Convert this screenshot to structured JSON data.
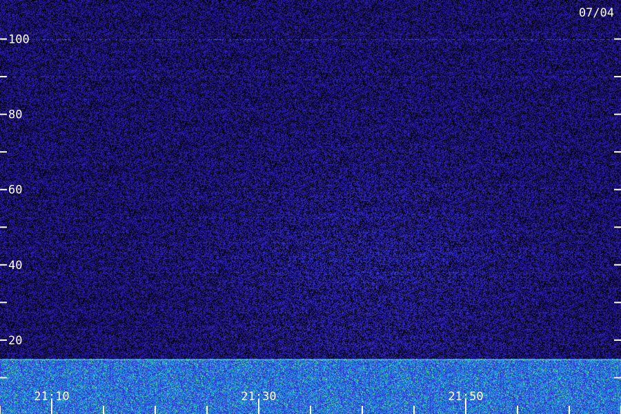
{
  "chart_data": {
    "type": "heatmap",
    "title": "",
    "xlabel": "",
    "ylabel": "",
    "date_label": "07/04",
    "x_tick_labels": [
      "21:10",
      "21:30",
      "21:50"
    ],
    "y_tick_labels": [
      "20",
      "40",
      "60",
      "80",
      "100"
    ],
    "y_tick_values": [
      20,
      40,
      60,
      80,
      100
    ],
    "y_minor_tick_values": [
      10,
      30,
      50,
      70,
      90
    ],
    "ylim": [
      0,
      110
    ],
    "x_range": [
      "21:05",
      "22:05"
    ],
    "x_label_times": [
      "21:10",
      "21:30",
      "21:50"
    ],
    "x_minor_tick_count": 12,
    "colormap": [
      "#1a0a6e",
      "#2a1aa8",
      "#3a3ae0",
      "#1f8fe8",
      "#19d6c8",
      "#7cf04a"
    ],
    "grid": false,
    "legend": "none"
  }
}
